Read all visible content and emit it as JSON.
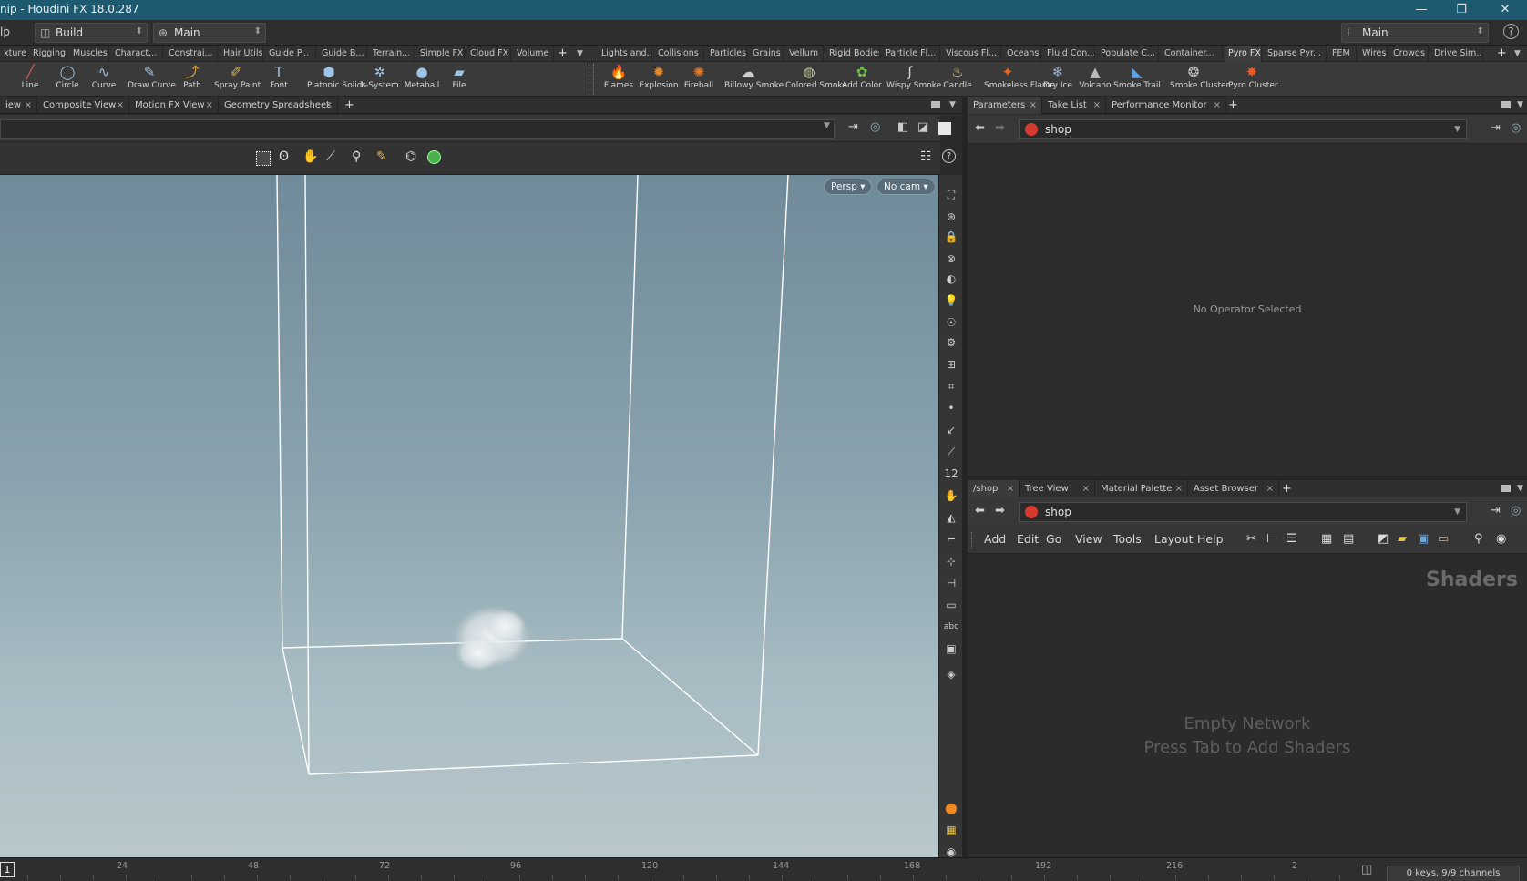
{
  "window": {
    "title": "nip - Houdini FX 18.0.287",
    "controls": [
      "—",
      "❐",
      "✕"
    ]
  },
  "menurow": {
    "left_fragment": "lp",
    "desktop_label": "Build",
    "network_label": "Main",
    "right_desktop_label": "Main",
    "help_icon": "?"
  },
  "shelf_tabs_left": [
    "xture",
    "Rigging",
    "Muscles",
    "Charact...",
    "Constrai...",
    "Hair Utils",
    "Guide P...",
    "Guide B...",
    "Terrain...",
    "Simple FX",
    "Cloud FX",
    "Volume"
  ],
  "shelf_tabs_right": [
    "Lights and...",
    "Collisions",
    "Particles",
    "Grains",
    "Vellum",
    "Rigid Bodies",
    "Particle Fl...",
    "Viscous Fl...",
    "Oceans",
    "Fluid Con...",
    "Populate C...",
    "Container...",
    "Pyro FX",
    "Sparse Pyr...",
    "FEM",
    "Wires",
    "Crowds",
    "Drive Sim..."
  ],
  "shelf_tools_left": [
    {
      "label": "Line",
      "icon": "line-icon",
      "glyph": "╱"
    },
    {
      "label": "Circle",
      "icon": "circle-icon",
      "glyph": "◯"
    },
    {
      "label": "Curve",
      "icon": "curve-icon",
      "glyph": "∿"
    },
    {
      "label": "Draw Curve",
      "icon": "draw-curve-icon",
      "glyph": "✎"
    },
    {
      "label": "Path",
      "icon": "path-icon",
      "glyph": "⤴"
    },
    {
      "label": "Spray Paint",
      "icon": "spray-paint-icon",
      "glyph": "✐"
    },
    {
      "label": "Font",
      "icon": "font-icon",
      "glyph": "T"
    },
    {
      "label": "Platonic Solids",
      "icon": "platonic-solids-icon",
      "glyph": "⬢"
    },
    {
      "label": "L-System",
      "icon": "l-system-icon",
      "glyph": "✲"
    },
    {
      "label": "Metaball",
      "icon": "metaball-icon",
      "glyph": "●"
    },
    {
      "label": "File",
      "icon": "file-icon",
      "glyph": "▰"
    }
  ],
  "shelf_tools_right": [
    {
      "label": "Flames",
      "icon": "flames-icon",
      "glyph": "🔥"
    },
    {
      "label": "Explosion",
      "icon": "explosion-icon",
      "glyph": "✹"
    },
    {
      "label": "Fireball",
      "icon": "fireball-icon",
      "glyph": "✺"
    },
    {
      "label": "Billowy Smoke",
      "icon": "billowy-smoke-icon",
      "glyph": "☁"
    },
    {
      "label": "Colored Smoke",
      "icon": "colored-smoke-icon",
      "glyph": "◍"
    },
    {
      "label": "Add Color",
      "icon": "add-color-icon",
      "glyph": "✿"
    },
    {
      "label": "Wispy Smoke",
      "icon": "wispy-smoke-icon",
      "glyph": "ʃ"
    },
    {
      "label": "Candle",
      "icon": "candle-icon",
      "glyph": "♨"
    },
    {
      "label": "Smokeless Flame",
      "icon": "smokeless-flame-icon",
      "glyph": "✦"
    },
    {
      "label": "Dry Ice",
      "icon": "dry-ice-icon",
      "glyph": "❄"
    },
    {
      "label": "Volcano",
      "icon": "volcano-icon",
      "glyph": "▲"
    },
    {
      "label": "Smoke Trail",
      "icon": "smoke-trail-icon",
      "glyph": "◣"
    },
    {
      "label": "Smoke Cluster",
      "icon": "smoke-cluster-icon",
      "glyph": "❂"
    },
    {
      "label": "Pyro Cluster",
      "icon": "pyro-cluster-icon",
      "glyph": "✸"
    }
  ],
  "viewport_tabs": [
    "iew",
    "Composite View",
    "Motion FX View",
    "Geometry Spreadsheet"
  ],
  "viewport": {
    "persp_label": "Persp ▾",
    "cam_label": "No cam ▾"
  },
  "param_tabs": [
    "Parameters",
    "Take List",
    "Performance Monitor"
  ],
  "param_path": "shop",
  "param_empty_text": "No Operator Selected",
  "net_tabs": [
    "/shop",
    "Tree View",
    "Material Palette",
    "Asset Browser"
  ],
  "net_path": "shop",
  "net_menu": [
    "Add",
    "Edit",
    "Go",
    "View",
    "Tools",
    "Layout",
    "Help"
  ],
  "net_context_label": "Shaders",
  "net_empty_line1": "Empty Network",
  "net_empty_line2": "Press Tab to Add Shaders",
  "timeline": {
    "current_frame": "1",
    "ticks": [
      "24",
      "48",
      "72",
      "96",
      "120",
      "144",
      "168",
      "192",
      "216",
      "2"
    ],
    "keys_label": "0 keys, 9/9 channels"
  },
  "colors": {
    "titlebar": "#1d5a70",
    "accent_orange": "#f08a24",
    "viewport_top": "#6f8a99",
    "viewport_bottom": "#b8c8cc"
  }
}
